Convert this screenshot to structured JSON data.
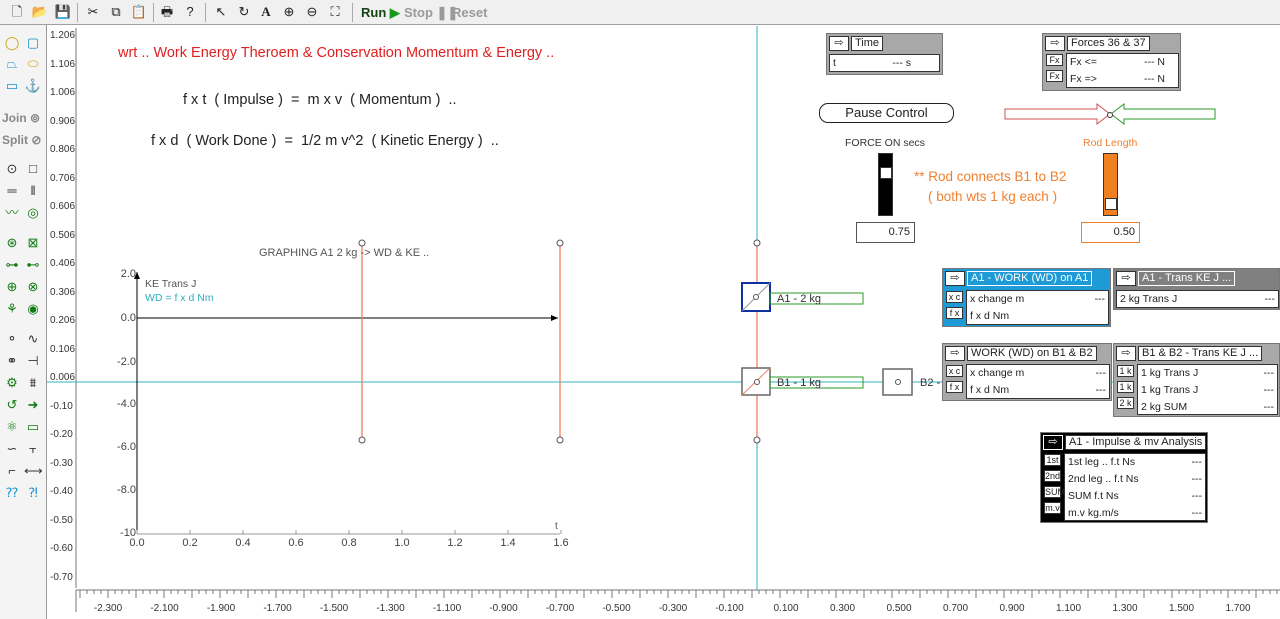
{
  "toolbar": {
    "run": "Run",
    "stop": "Stop",
    "reset": "Reset"
  },
  "palette": {
    "join": "Join",
    "split": "Split"
  },
  "y_ruler": [
    "1.206",
    "1.106",
    "1.006",
    "0.906",
    "0.806",
    "0.706",
    "0.606",
    "0.506",
    "0.406",
    "0.306",
    "0.206",
    "0.106",
    "0.006",
    "-0.10",
    "-0.20",
    "-0.30",
    "-0.40",
    "-0.50",
    "-0.60",
    "-0.70"
  ],
  "x_ruler": [
    "-2.300",
    "-2.100",
    "-1.900",
    "-1.700",
    "-1.500",
    "-1.300",
    "-1.100",
    "-0.900",
    "-0.700",
    "-0.500",
    "-0.300",
    "-0.100",
    "0.100",
    "0.300",
    "0.500",
    "0.700",
    "0.900",
    "1.100",
    "1.300",
    "1.500",
    "1.700"
  ],
  "canvas": {
    "title": "wrt .. Work Energy Theroem & Conservation Momentum & Energy ..",
    "eq1": "f x t  ( Impulse )  =  m x v  ( Momentum )  ..",
    "eq2": "f x d  ( Work Done )  =  1/2 m v^2  ( Kinetic Energy )  ..",
    "rod_note1": "** Rod connects B1 to B2",
    "rod_note2": "( both wts 1 kg each )",
    "force_on_label": "FORCE ON secs",
    "force_on_value": "0.75",
    "rod_length_label": "Rod Length",
    "rod_length_value": "0.50",
    "pause_control": "Pause Control",
    "body_a1": "A1 - 2 kg",
    "body_b1": "B1 - 1 kg",
    "body_b2": "B2 - 1 kg"
  },
  "graph": {
    "title": "GRAPHING A1 2 kg -> WD & KE ..",
    "legend1": "KE Trans J",
    "legend2": "WD = f x d Nm",
    "x_ticks": [
      "0.0",
      "0.2",
      "0.4",
      "0.6",
      "0.8",
      "1.0",
      "1.2",
      "1.4",
      "1.6"
    ],
    "y_ticks": [
      "2.0",
      "0.0",
      "-2.0",
      "-4.0",
      "-6.0",
      "-8.0",
      "-10"
    ],
    "x_unit": "t"
  },
  "panels": {
    "time": {
      "title": "Time",
      "row_label": "t",
      "row_value": "--- s"
    },
    "forces": {
      "title": "Forces 36 & 37",
      "rows": [
        {
          "tag": "Fx",
          "label": "Fx <=",
          "value": "--- N"
        },
        {
          "tag": "Fx",
          "label": "Fx =>",
          "value": "--- N"
        }
      ]
    },
    "a1_work": {
      "title": "A1 - WORK (WD) on A1",
      "rows": [
        {
          "tag": "x c",
          "label": "x change m",
          "value": "---"
        },
        {
          "tag": "f x",
          "label": "f x d Nm",
          "value": ""
        }
      ]
    },
    "a1_ke": {
      "title": "A1 - Trans KE J ...",
      "rows": [
        {
          "label": "2 kg Trans J",
          "value": "---"
        }
      ]
    },
    "b_work": {
      "title": "WORK (WD) on B1 & B2",
      "rows": [
        {
          "tag": "x c",
          "label": "x change m",
          "value": "---"
        },
        {
          "tag": "f x",
          "label": "f x d Nm",
          "value": "---"
        }
      ]
    },
    "b_ke": {
      "title": "B1 & B2 - Trans KE J ...",
      "rows": [
        {
          "tag": "1 k",
          "label": "1 kg Trans J",
          "value": "---"
        },
        {
          "tag": "1 k",
          "label": "1 kg Trans J",
          "value": "---"
        },
        {
          "tag": "2 k",
          "label": "2 kg SUM",
          "value": "---"
        }
      ]
    },
    "impulse": {
      "title": "A1 - Impulse & mv Analysis",
      "rows": [
        {
          "tag": "1st",
          "label": "1st leg .. f.t Ns",
          "value": "---"
        },
        {
          "tag": "2nd",
          "label": "2nd leg .. f.t Ns",
          "value": "---"
        },
        {
          "tag": "SUM",
          "label": "SUM f.t Ns",
          "value": "---"
        },
        {
          "tag": "m.v",
          "label": "m.v kg.m/s",
          "value": "---"
        }
      ]
    }
  },
  "colors": {
    "title_red": "#e02020",
    "orange": "#f08030",
    "axis_teal": "#30b0c0",
    "panel_blue": "#1e9ad6"
  }
}
